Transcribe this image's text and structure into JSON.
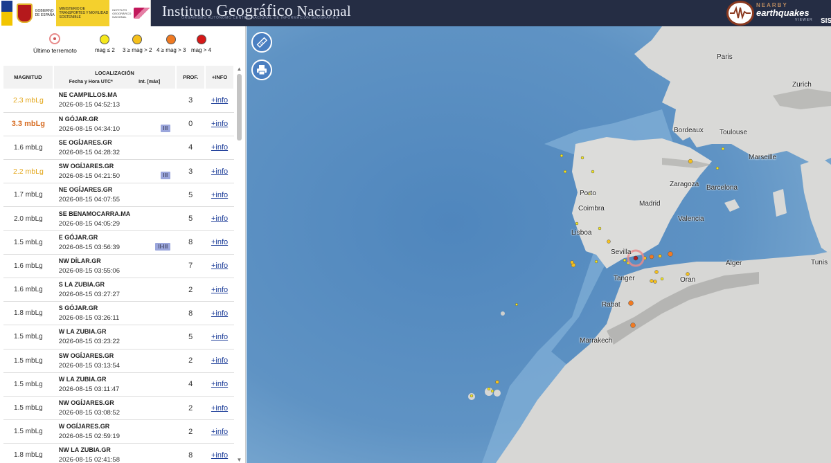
{
  "header": {
    "gov_text": "GOBIERNO DE ESPAÑA",
    "ministry_text": "MINISTERIO DE TRANSPORTES Y MOVILIDAD SOSTENIBLE",
    "institute_text": "INSTITUTO GEOGRÁFICO NACIONAL",
    "title_part1": "Instituto",
    "title_part2": "Geográfico",
    "title_part3": "Nacional",
    "subtitle": "ORGANISMO AUTÓNOMO  CENTRO NACIONAL DE INFORMACIÓN GEOGRÁFICA",
    "brand_nearby": "NEARBY",
    "brand_earthquakes": "earthquakes",
    "brand_viewer": "VIEWER",
    "brand_sis": "SIS"
  },
  "legend": {
    "latest": "Último terremoto",
    "items": [
      {
        "label": "mag ≤ 2",
        "color": "#f5e81c"
      },
      {
        "label": "3 ≥ mag > 2",
        "color": "#f5c01c"
      },
      {
        "label": "4 ≥ mag > 3",
        "color": "#f07a22"
      },
      {
        "label": "mag > 4",
        "color": "#d61818"
      }
    ]
  },
  "table": {
    "headers": {
      "magnitude": "MAGNITUD",
      "location": "LOCALIZACIÓN",
      "datetime": "Fecha y Hora UTC*",
      "intensity": "Int. [máx]",
      "depth": "PROF.",
      "info": "+INFO"
    },
    "rows": [
      {
        "mag": "2.3 mbLg",
        "level": "yellow",
        "place": "NE CAMPILLOS.MA",
        "date": "2026-08-15 04:52:13",
        "int": "",
        "depth": "3",
        "info": "+info"
      },
      {
        "mag": "3.3 mbLg",
        "level": "orange",
        "place": "N GÓJAR.GR",
        "date": "2026-08-15 04:34:10",
        "int": "III",
        "depth": "0",
        "info": "+info"
      },
      {
        "mag": "1.6 mbLg",
        "level": "low",
        "place": "SE OGÍJARES.GR",
        "date": "2026-08-15 04:28:32",
        "int": "",
        "depth": "4",
        "info": "+info"
      },
      {
        "mag": "2.2 mbLg",
        "level": "yellow",
        "place": "SW OGÍJARES.GR",
        "date": "2026-08-15 04:21:50",
        "int": "III",
        "depth": "3",
        "info": "+info"
      },
      {
        "mag": "1.7 mbLg",
        "level": "low",
        "place": "NE OGÍJARES.GR",
        "date": "2026-08-15 04:07:55",
        "int": "",
        "depth": "5",
        "info": "+info"
      },
      {
        "mag": "2.0 mbLg",
        "level": "low",
        "place": "SE BENAMOCARRA.MA",
        "date": "2026-08-15 04:05:29",
        "int": "",
        "depth": "5",
        "info": "+info"
      },
      {
        "mag": "1.5 mbLg",
        "level": "low",
        "place": "E GÓJAR.GR",
        "date": "2026-08-15 03:56:39",
        "int": "II-III",
        "depth": "8",
        "info": "+info"
      },
      {
        "mag": "1.6 mbLg",
        "level": "low",
        "place": "NW DÍLAR.GR",
        "date": "2026-08-15 03:55:06",
        "int": "",
        "depth": "7",
        "info": "+info"
      },
      {
        "mag": "1.6 mbLg",
        "level": "low",
        "place": "S LA ZUBIA.GR",
        "date": "2026-08-15 03:27:27",
        "int": "",
        "depth": "2",
        "info": "+info"
      },
      {
        "mag": "1.8 mbLg",
        "level": "low",
        "place": "S GÓJAR.GR",
        "date": "2026-08-15 03:26:11",
        "int": "",
        "depth": "8",
        "info": "+info"
      },
      {
        "mag": "1.5 mbLg",
        "level": "low",
        "place": "W LA ZUBIA.GR",
        "date": "2026-08-15 03:23:22",
        "int": "",
        "depth": "5",
        "info": "+info"
      },
      {
        "mag": "1.5 mbLg",
        "level": "low",
        "place": "SW OGÍJARES.GR",
        "date": "2026-08-15 03:13:54",
        "int": "",
        "depth": "2",
        "info": "+info"
      },
      {
        "mag": "1.5 mbLg",
        "level": "low",
        "place": "W LA ZUBIA.GR",
        "date": "2026-08-15 03:11:47",
        "int": "",
        "depth": "4",
        "info": "+info"
      },
      {
        "mag": "1.5 mbLg",
        "level": "low",
        "place": "NW OGÍJARES.GR",
        "date": "2026-08-15 03:08:52",
        "int": "",
        "depth": "2",
        "info": "+info"
      },
      {
        "mag": "1.5 mbLg",
        "level": "low",
        "place": "W OGÍJARES.GR",
        "date": "2026-08-15 02:59:19",
        "int": "",
        "depth": "2",
        "info": "+info"
      },
      {
        "mag": "1.8 mbLg",
        "level": "low",
        "place": "NW LA ZUBIA.GR",
        "date": "2026-08-15 02:41:58",
        "int": "",
        "depth": "8",
        "info": "+info"
      }
    ]
  },
  "map": {
    "cities": [
      "Paris",
      "Zurich",
      "Bordeaux",
      "Toulouse",
      "Marseille",
      "Zaragoza",
      "Barcelona",
      "Porto",
      "Coimbra",
      "Madrid",
      "Valencia",
      "Lisboa",
      "Sevilla",
      "Alger",
      "Tunis",
      "Tanger",
      "Oran",
      "Rabat",
      "Marrakech"
    ],
    "colors": {
      "ocean": "#5d8fc0",
      "land": "#d7d7d5",
      "mountains": "#a9a9a6",
      "latest": "#e88b8b"
    },
    "tools": [
      "ruler-icon",
      "printer-icon"
    ]
  }
}
